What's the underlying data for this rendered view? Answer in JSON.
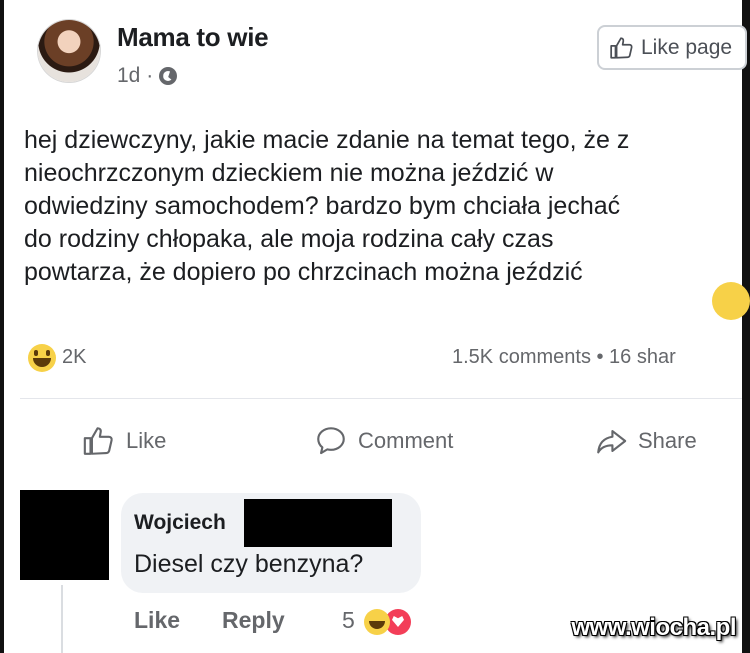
{
  "post": {
    "page_name": "Mama to wie",
    "time": "1d ·",
    "like_page_label": "Like page",
    "text": "hej dziewczyny, jakie macie zdanie na temat tego, że z\nnieochrzczonym dzieckiem nie można jeździć w\nodwiedziny samochodem? bardzo bym chciała jechać\ndo rodziny chłopaka, ale moja rodzina cały czas\npowtarza, że dopiero po chrzcinach można jeździć",
    "reactions_count": "2K",
    "engagement": "1.5K comments • 16 shar"
  },
  "actions": {
    "like": "Like",
    "comment": "Comment",
    "share": "Share"
  },
  "comment": {
    "author": "Wojciech",
    "text": "Diesel czy benzyna?",
    "like_label": "Like",
    "reply_label": "Reply",
    "reaction_count": "5"
  },
  "watermark": "www.wiocha.pl",
  "colors": {
    "text": "#1c1e21",
    "secondary": "#65676b",
    "bubble": "#f0f2f5",
    "haha": "#f7d148",
    "love": "#f33e58"
  },
  "icons": [
    "globe-icon",
    "thumbs-up-icon",
    "comment-icon",
    "share-icon",
    "haha-reaction-icon",
    "love-reaction-icon"
  ]
}
